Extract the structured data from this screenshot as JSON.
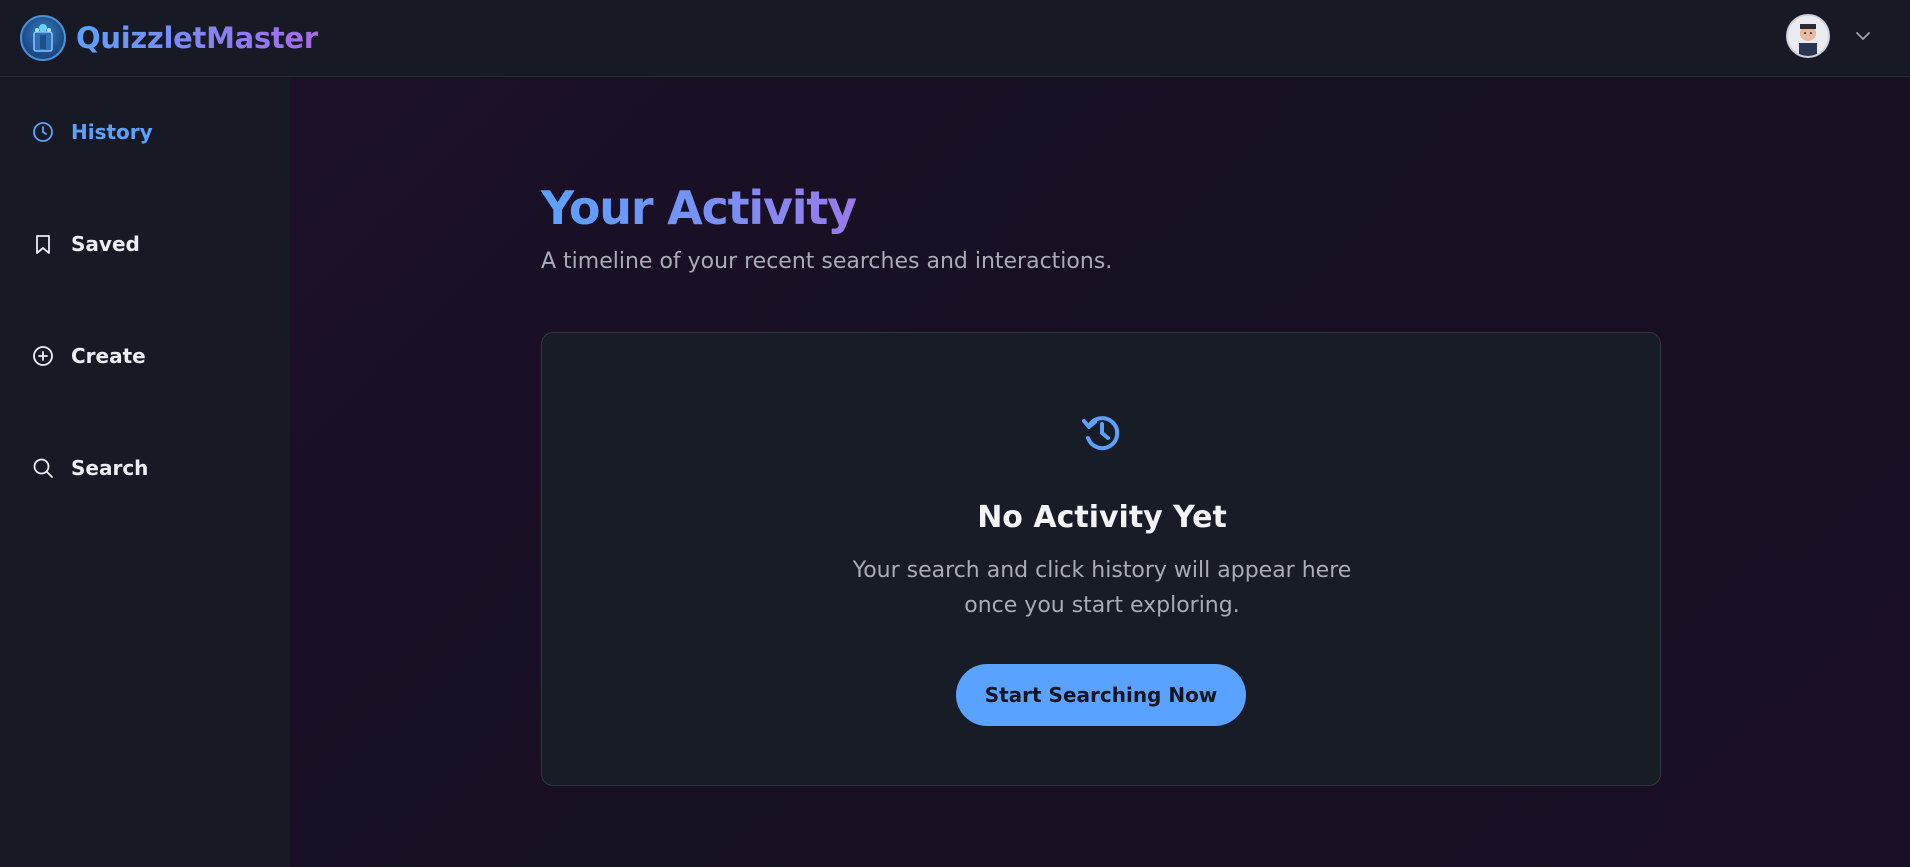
{
  "header": {
    "brand_name": "QuizzletMaster",
    "logo_icon": "quizzlet-logo-icon",
    "avatar_icon": "user-avatar",
    "menu_icon": "chevron-down-icon"
  },
  "sidebar": {
    "items": [
      {
        "label": "History",
        "icon": "clock-icon",
        "active": true
      },
      {
        "label": "Saved",
        "icon": "bookmark-icon",
        "active": false
      },
      {
        "label": "Create",
        "icon": "plus-circle-icon",
        "active": false
      },
      {
        "label": "Search",
        "icon": "search-icon",
        "active": false
      }
    ]
  },
  "main": {
    "title": "Your Activity",
    "subtitle": "A timeline of your recent searches and interactions.",
    "empty_state": {
      "icon": "history-icon",
      "title": "No Activity Yet",
      "text_line1": "Your search and click history will appear here",
      "text_line2": "once you start exploring.",
      "button_label": "Start Searching Now"
    }
  },
  "colors": {
    "accent": "#5aa2ff",
    "accent_purple": "#a86ae6",
    "background": "#12131f",
    "panel": "#171a24",
    "card": "#181c26"
  }
}
